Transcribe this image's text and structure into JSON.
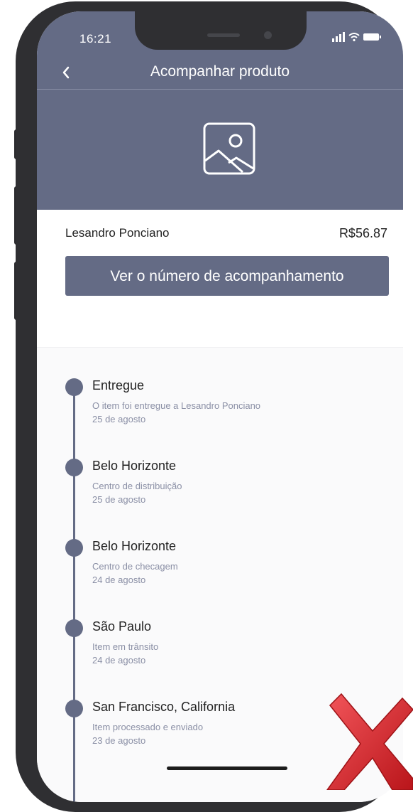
{
  "status_bar": {
    "time": "16:21"
  },
  "header": {
    "title": "Acompanhar produto"
  },
  "order": {
    "seller": "Lesandro Ponciano",
    "price": "R$56.87",
    "track_button_label": "Ver o número de acompanhamento"
  },
  "timeline": [
    {
      "title": "Entregue",
      "description": "O item foi entregue a Lesandro Ponciano",
      "date": "25 de agosto"
    },
    {
      "title": "Belo Horizonte",
      "description": "Centro de distribuição",
      "date": "25 de agosto"
    },
    {
      "title": "Belo Horizonte",
      "description": "Centro de checagem",
      "date": "24 de agosto"
    },
    {
      "title": "São Paulo",
      "description": "Item em trânsito",
      "date": "24 de agosto"
    },
    {
      "title": "San Francisco, California",
      "description": "Item processado e enviado",
      "date": "23 de agosto"
    }
  ],
  "colors": {
    "accent": "#646b85",
    "frame": "#2f2f32",
    "overlay_x": "#e0262b"
  },
  "icons": [
    "back-chevron-icon",
    "signal-icon",
    "wifi-icon",
    "battery-icon",
    "image-placeholder-icon",
    "red-x-mark-icon"
  ]
}
